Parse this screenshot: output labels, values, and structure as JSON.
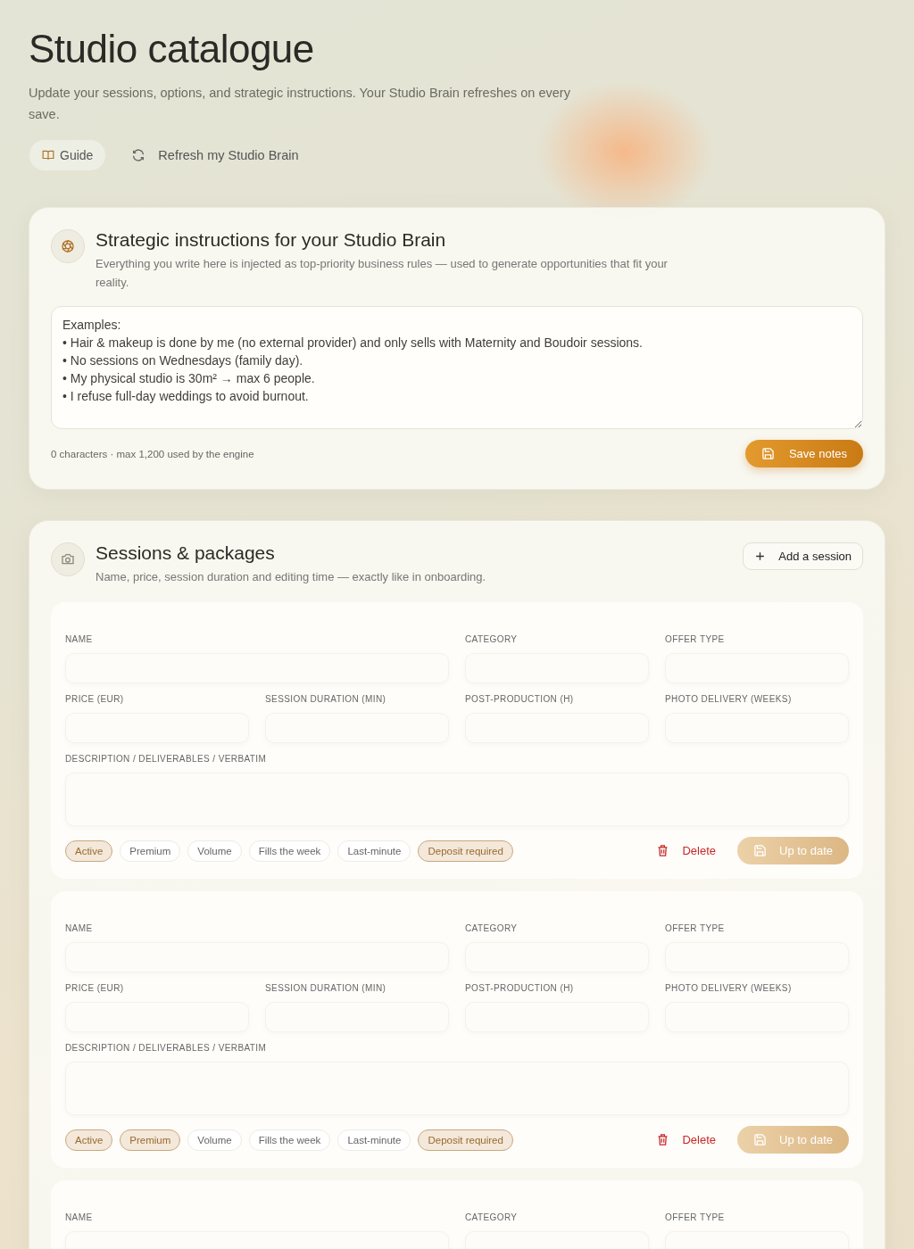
{
  "header": {
    "title": "Studio catalogue",
    "subtitle": "Update your sessions, options, and strategic instructions. Your Studio Brain refreshes on every save.",
    "actions": [
      {
        "label": "Guide",
        "kind": "guide"
      },
      {
        "label": "Refresh my Studio Brain",
        "kind": "refresh"
      }
    ]
  },
  "strategic": {
    "title": "Strategic instructions for your Studio Brain",
    "description": "Everything you write here is injected as top-priority business rules — used to generate opportunities that fit your reality.",
    "notes": {
      "placeholder": "Examples:\n• Hair & makeup is done by me (no external provider) and only sells with Maternity and Boudoir sessions.\n• No sessions on Wednesdays (family day).\n• My physical studio is 30m² → max 6 people.\n• I refuse full-day weddings to avoid burnout."
    },
    "counter": "0 characters · max 1,200 used by the engine",
    "save_button": "Save notes"
  },
  "sessions": {
    "title": "Sessions & packages",
    "description": "Name, price, session duration and editing time — exactly like in onboarding.",
    "add_button": "Add a session",
    "cards": [
      {
        "fields": [
          {
            "label": "NAME",
            "kind": "input"
          },
          {
            "label": "CATEGORY",
            "kind": "input"
          },
          {
            "label": "OFFER TYPE",
            "kind": "input"
          },
          {
            "label": "PRICE (EUR)",
            "kind": "input"
          },
          {
            "label": "SESSION DURATION (MIN)",
            "kind": "input"
          },
          {
            "label": "POST-PRODUCTION (H)",
            "kind": "input"
          },
          {
            "label": "PHOTO DELIVERY (WEEKS)",
            "kind": "input"
          },
          {
            "label": "DESCRIPTION / DELIVERABLES / VERBATIM",
            "kind": "textarea"
          }
        ],
        "tags": [
          {
            "label": "Active",
            "selected": true
          },
          {
            "label": "Premium",
            "selected": false
          },
          {
            "label": "Volume",
            "selected": false
          },
          {
            "label": "Fills the week",
            "selected": false
          },
          {
            "label": "Last-minute",
            "selected": false
          },
          {
            "label": "Deposit required",
            "selected": true
          }
        ],
        "delete_button": "Delete",
        "status_button": "Up to date"
      },
      {
        "fields": [
          {
            "label": "NAME",
            "kind": "input"
          },
          {
            "label": "CATEGORY",
            "kind": "input"
          },
          {
            "label": "OFFER TYPE",
            "kind": "input"
          },
          {
            "label": "PRICE (EUR)",
            "kind": "input"
          },
          {
            "label": "SESSION DURATION (MIN)",
            "kind": "input"
          },
          {
            "label": "POST-PRODUCTION (H)",
            "kind": "input"
          },
          {
            "label": "PHOTO DELIVERY (WEEKS)",
            "kind": "input"
          },
          {
            "label": "DESCRIPTION / DELIVERABLES / VERBATIM",
            "kind": "textarea"
          }
        ],
        "tags": [
          {
            "label": "Active",
            "selected": true
          },
          {
            "label": "Premium",
            "selected": true
          },
          {
            "label": "Volume",
            "selected": false
          },
          {
            "label": "Fills the week",
            "selected": false
          },
          {
            "label": "Last-minute",
            "selected": false
          },
          {
            "label": "Deposit required",
            "selected": true
          }
        ],
        "delete_button": "Delete",
        "status_button": "Up to date"
      },
      {
        "fields": [
          {
            "label": "NAME",
            "kind": "input"
          },
          {
            "label": "CATEGORY",
            "kind": "input"
          },
          {
            "label": "OFFER TYPE",
            "kind": "input"
          }
        ]
      }
    ]
  }
}
